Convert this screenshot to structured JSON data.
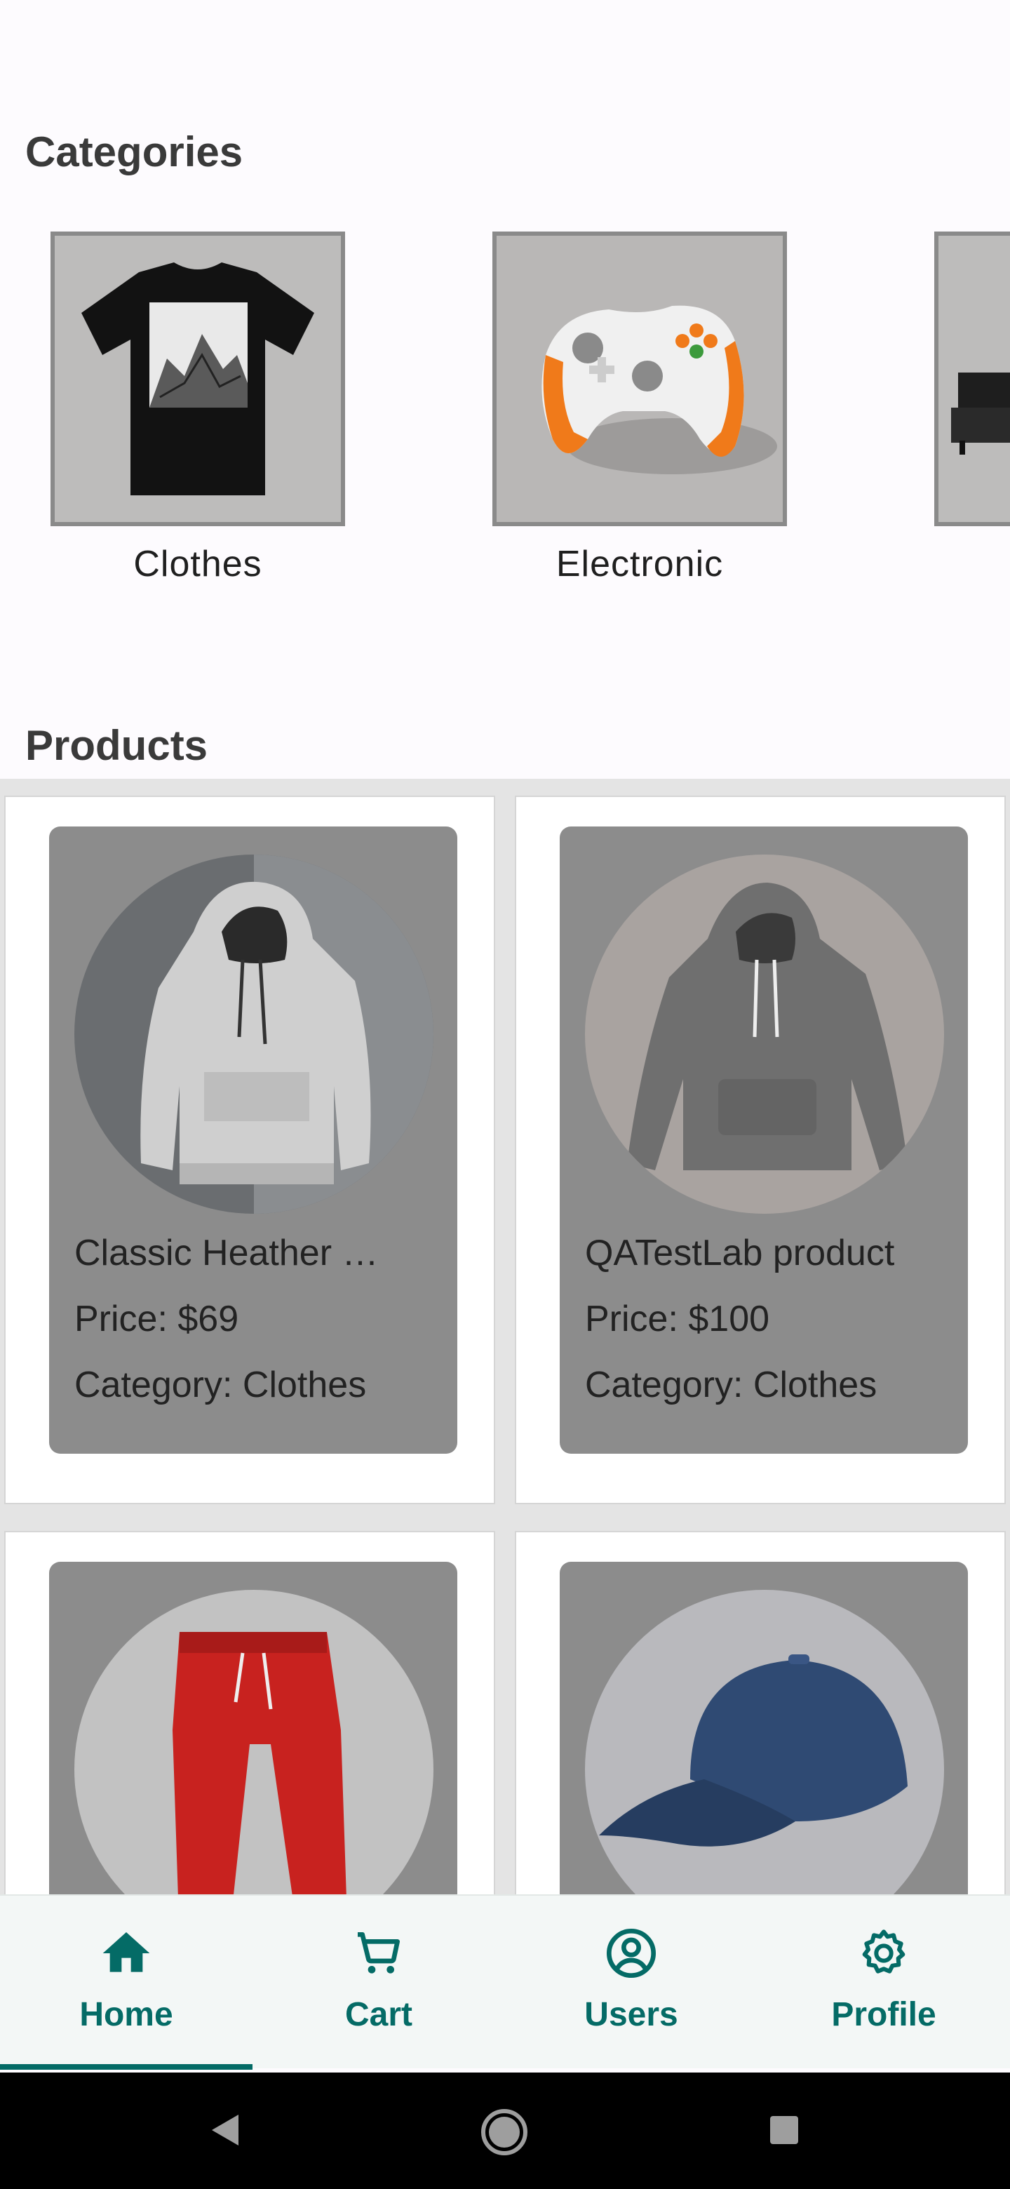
{
  "sections": {
    "categories_title": "Categories",
    "products_title": "Products"
  },
  "categories": [
    {
      "label": "Clothes",
      "icon": "tshirt-image"
    },
    {
      "label": "Electronic",
      "icon": "game-controller-image"
    },
    {
      "label": "",
      "icon": "sofa-image"
    }
  ],
  "products": [
    {
      "name": "Classic Heather …",
      "price": "Price: $69",
      "category": "Category: Clothes",
      "icon": "hoodie-image"
    },
    {
      "name": "QATestLab product",
      "price": "Price: $100",
      "category": "Category: Clothes",
      "icon": "hoodie-image"
    },
    {
      "name": "",
      "price": "",
      "category": "",
      "icon": "red-pants-image"
    },
    {
      "name": "",
      "price": "",
      "category": "",
      "icon": "cap-image"
    }
  ],
  "nav": {
    "items": [
      {
        "label": "Home",
        "icon": "home-icon"
      },
      {
        "label": "Cart",
        "icon": "cart-icon"
      },
      {
        "label": "Users",
        "icon": "user-circle-icon"
      },
      {
        "label": "Profile",
        "icon": "gear-icon"
      }
    ]
  },
  "colors": {
    "accent": "#046b66",
    "card_inner": "#8c8c8c",
    "nav_bg": "#f3f7f6"
  }
}
